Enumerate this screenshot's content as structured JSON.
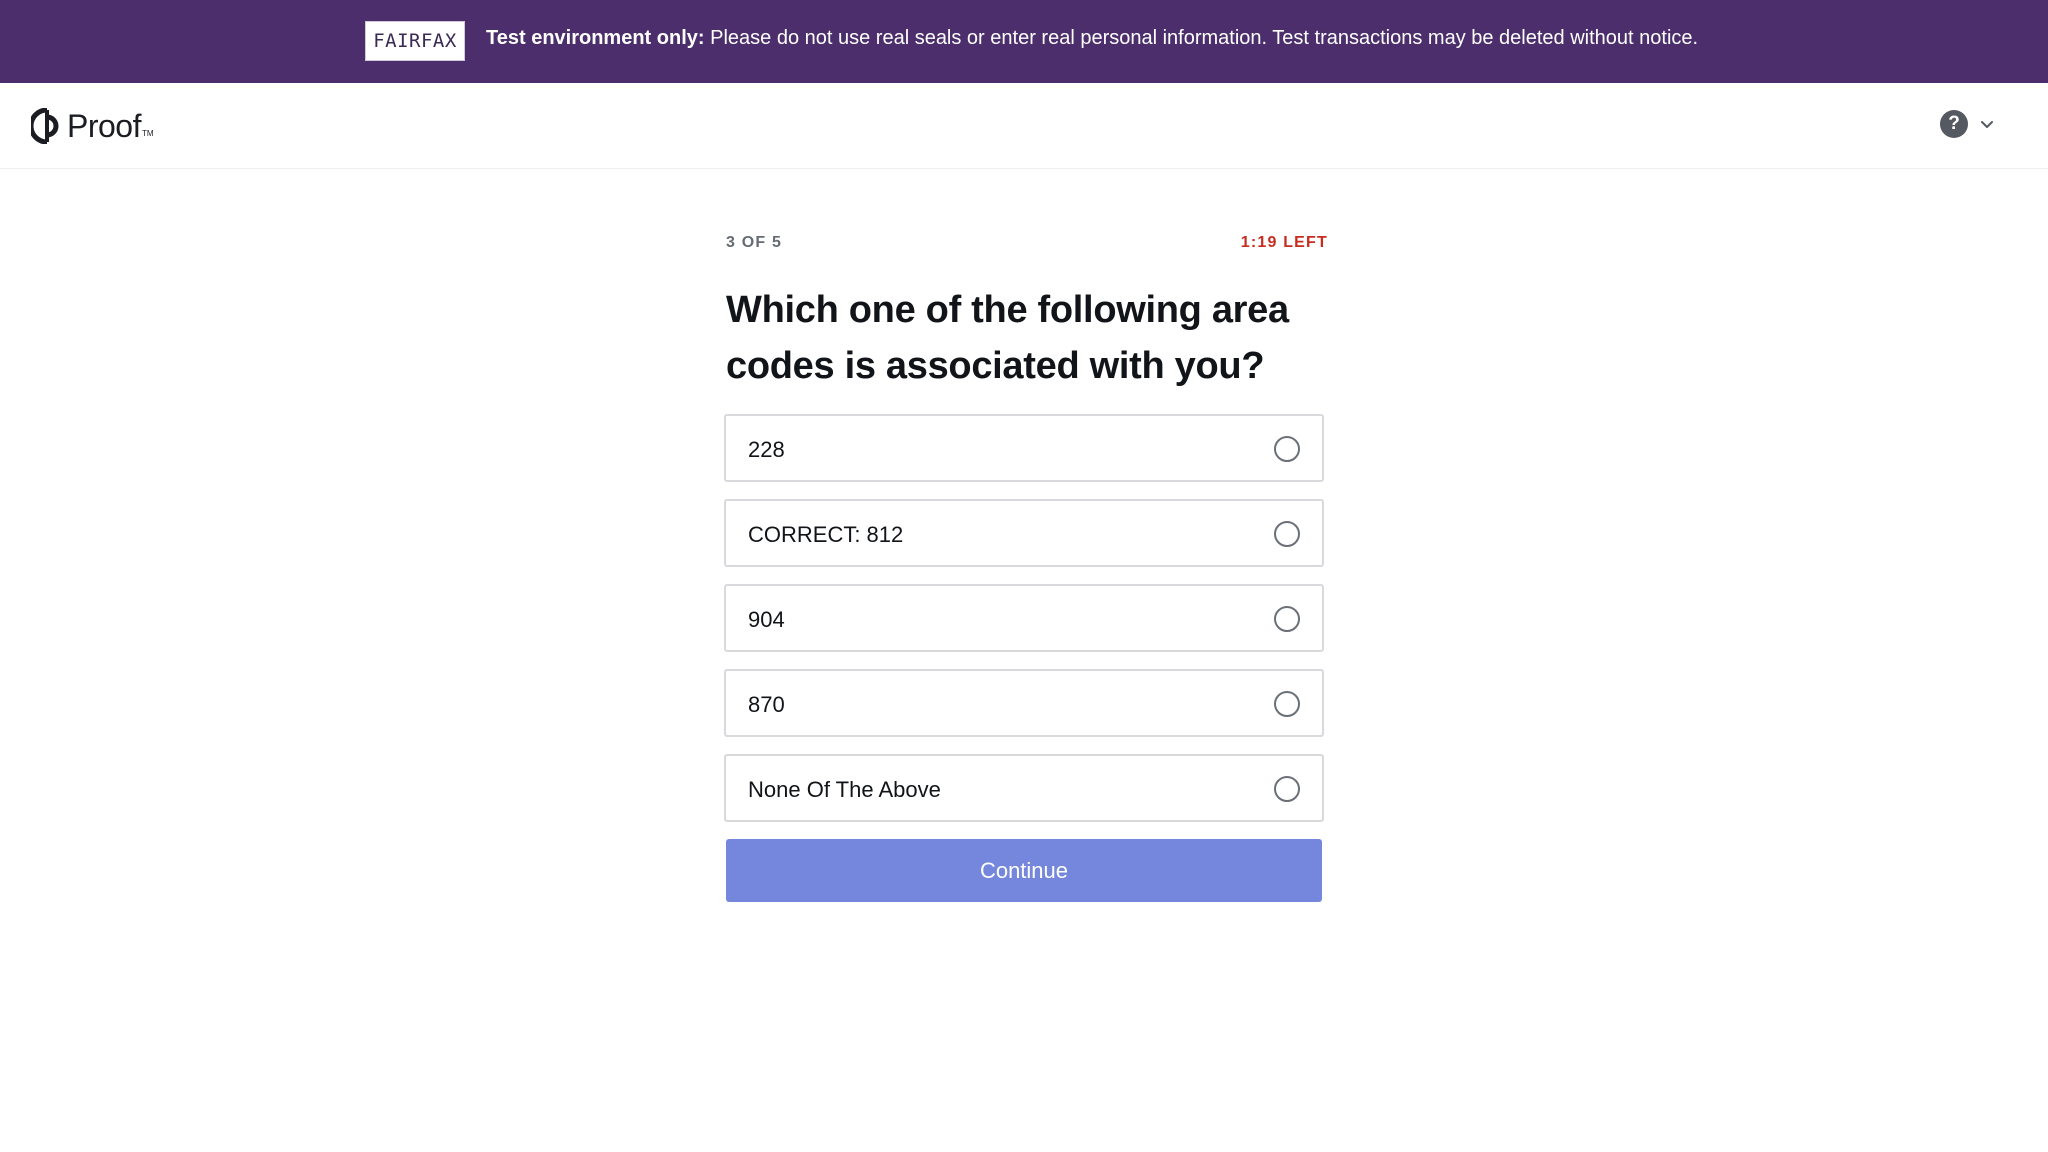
{
  "banner": {
    "badge": "FAIRFAX",
    "label": "Test environment only:",
    "message": "Please do not use real seals or enter real personal information. Test transactions may be deleted without notice."
  },
  "header": {
    "logo_text": "Proof",
    "logo_tm": "TM",
    "help_icon": "question-mark-icon",
    "menu_icon": "chevron-down-icon",
    "help_symbol": "?"
  },
  "quiz": {
    "progress": "3 OF 5",
    "timer": "1:19 LEFT",
    "question": "Which one of the following area codes is associated with you?",
    "options": [
      {
        "label": "228"
      },
      {
        "label": "CORRECT: 812"
      },
      {
        "label": "904"
      },
      {
        "label": "870"
      },
      {
        "label": "None Of The Above"
      }
    ],
    "continue_label": "Continue"
  },
  "colors": {
    "banner_bg": "#4b2e6b",
    "timer": "#c62d20",
    "continue_bg": "#7587dd",
    "option_border": "#d7d9dd"
  }
}
